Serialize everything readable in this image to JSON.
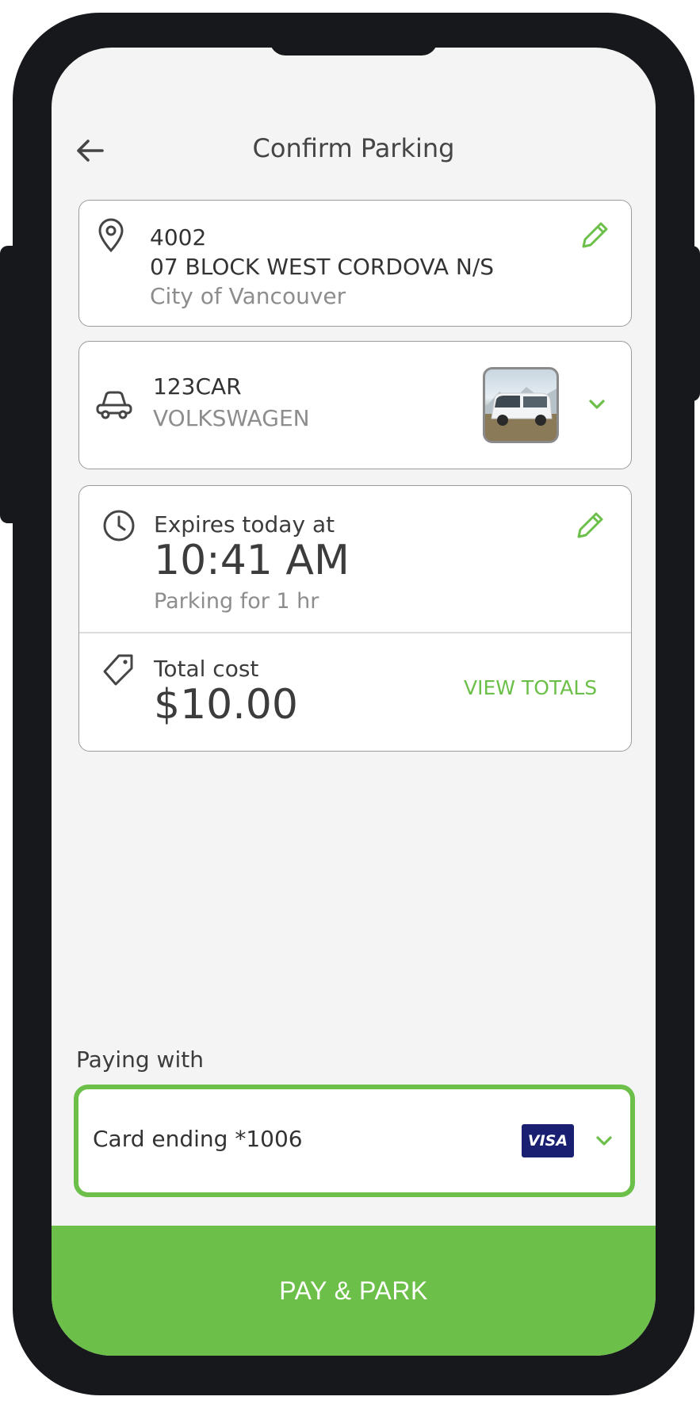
{
  "header": {
    "title": "Confirm Parking"
  },
  "location": {
    "number": "4002",
    "street": "07 BLOCK WEST CORDOVA N/S",
    "city": "City of Vancouver"
  },
  "vehicle": {
    "plate": "123CAR",
    "make": "VOLKSWAGEN"
  },
  "session": {
    "expires_label": "Expires today at",
    "expires_time": "10:41 AM",
    "duration": "Parking for 1 hr",
    "total_label": "Total cost",
    "total_value": "$10.00",
    "view_totals": "VIEW TOTALS"
  },
  "payment": {
    "label": "Paying with",
    "card_text": "Card ending *1006",
    "card_brand": "VISA"
  },
  "action": {
    "pay_park": "PAY & PARK"
  },
  "colors": {
    "accent": "#6cc04a",
    "visa_blue": "#1a1f71",
    "text_dark": "#3c3c3c",
    "text_muted": "#8d8d8d"
  },
  "icons": {
    "back": "arrow-left-icon",
    "location": "map-pin-icon",
    "edit": "pencil-icon",
    "vehicle": "car-icon",
    "dropdown": "chevron-down-icon",
    "time": "clock-icon",
    "cost": "price-tag-icon"
  }
}
